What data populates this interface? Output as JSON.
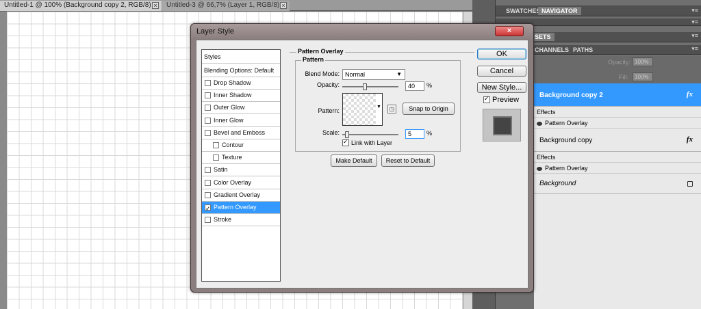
{
  "doc_tabs": [
    {
      "label": "Untitled-1 @ 100% (Background copy 2, RGB/8) *",
      "close": "×"
    },
    {
      "label": "Untitled-3 @ 66,7% (Layer 1, RGB/8) *",
      "close": "×"
    }
  ],
  "panels": {
    "top_tabs": [
      "SWATCHES",
      "NAVIGATOR"
    ],
    "collapsed_tab_partial": "SETS",
    "layer_tabs": [
      "CHANNELS",
      "PATHS"
    ],
    "menu_glyph": "▾≡",
    "opacity_label": "Opacity:",
    "opacity_value": "100%",
    "fill_label": "Fill:",
    "fill_value": "100%"
  },
  "layers": [
    {
      "name": "Background copy 2",
      "fx": "fx",
      "effects_label": "Effects",
      "effect": "Pattern Overlay",
      "selected": true
    },
    {
      "name": "Background copy",
      "fx": "fx",
      "effects_label": "Effects",
      "effect": "Pattern Overlay",
      "selected": false
    },
    {
      "name": "Background",
      "locked": true
    }
  ],
  "dialog": {
    "title": "Layer Style",
    "close": "×",
    "styles_header": "Styles",
    "blending_options": "Blending Options: Default",
    "style_items": [
      {
        "label": "Drop Shadow",
        "checked": false,
        "indent": false
      },
      {
        "label": "Inner Shadow",
        "checked": false,
        "indent": false
      },
      {
        "label": "Outer Glow",
        "checked": false,
        "indent": false
      },
      {
        "label": "Inner Glow",
        "checked": false,
        "indent": false
      },
      {
        "label": "Bevel and Emboss",
        "checked": false,
        "indent": false
      },
      {
        "label": "Contour",
        "checked": false,
        "indent": true
      },
      {
        "label": "Texture",
        "checked": false,
        "indent": true
      },
      {
        "label": "Satin",
        "checked": false,
        "indent": false
      },
      {
        "label": "Color Overlay",
        "checked": false,
        "indent": false
      },
      {
        "label": "Gradient Overlay",
        "checked": false,
        "indent": false
      },
      {
        "label": "Pattern Overlay",
        "checked": true,
        "indent": false,
        "selected": true
      },
      {
        "label": "Stroke",
        "checked": false,
        "indent": false
      }
    ],
    "section_title": "Pattern Overlay",
    "group_title": "Pattern",
    "blend_mode_label": "Blend Mode:",
    "blend_mode_value": "Normal",
    "opacity_label": "Opacity:",
    "opacity_value": "40",
    "opacity_level": 0.4,
    "pct": "%",
    "pattern_label": "Pattern:",
    "snap_button": "Snap to Origin",
    "scale_label": "Scale:",
    "scale_value": "5",
    "scale_level": 0.05,
    "link_with_layer": "Link with Layer",
    "link_checked": true,
    "make_default": "Make Default",
    "reset_default": "Reset to Default",
    "ok": "OK",
    "cancel": "Cancel",
    "new_style": "New Style...",
    "preview_label": "Preview",
    "preview_checked": true
  },
  "colors": {
    "selection": "#3399ff",
    "close_button": "#cc3333"
  }
}
